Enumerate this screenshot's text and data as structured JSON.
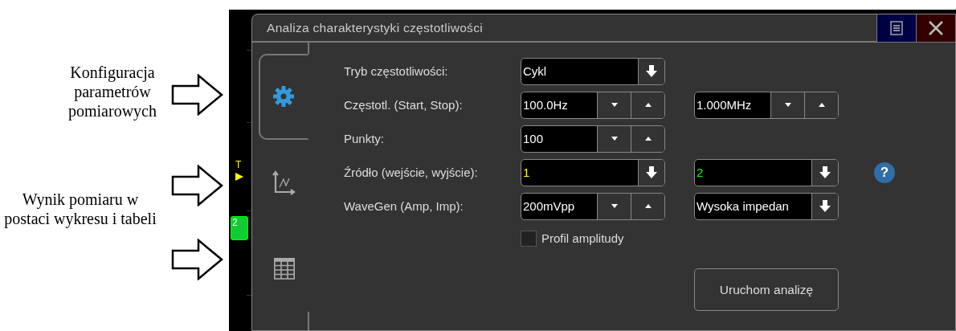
{
  "annotations": [
    {
      "text": "Konfiguracja parametrów pomiarowych"
    },
    {
      "text": "Wynik pomiaru w postaci wykresu i tabeli"
    }
  ],
  "scope": {
    "trigger_label": "T",
    "channel_badge": "2"
  },
  "window": {
    "title": "Analiza charakterystyki częstotliwości"
  },
  "tabs": [
    {
      "kind": "settings",
      "selected": true
    },
    {
      "kind": "chart",
      "selected": false
    },
    {
      "kind": "table",
      "selected": false
    }
  ],
  "rows": [
    {
      "label": "Tryb częstotliwości:",
      "controls": [
        {
          "kind": "dropdown",
          "value": "Cykl"
        }
      ]
    },
    {
      "label": "Częstotl. (Start, Stop):",
      "controls": [
        {
          "kind": "spinner",
          "value": "100.0Hz"
        },
        {
          "kind": "spinner",
          "value": "1.000MHz"
        }
      ]
    },
    {
      "label": "Punkty:",
      "controls": [
        {
          "kind": "spinner",
          "value": "100"
        }
      ]
    },
    {
      "label": "Źródło (wejście, wyjście):",
      "controls": [
        {
          "kind": "dropdown",
          "value": "1",
          "color": "#ffff00"
        },
        {
          "kind": "dropdown",
          "value": "2",
          "color": "#00ff00"
        }
      ],
      "help": "?"
    },
    {
      "label": "WaveGen (Amp, Imp):",
      "controls": [
        {
          "kind": "spinner",
          "value": "200mVpp"
        },
        {
          "kind": "dropdown",
          "value": "Wysoka impedan"
        }
      ]
    }
  ],
  "checkbox": {
    "label": "Profil amplitudy",
    "checked": false
  },
  "run_button": "Uruchom analizę"
}
